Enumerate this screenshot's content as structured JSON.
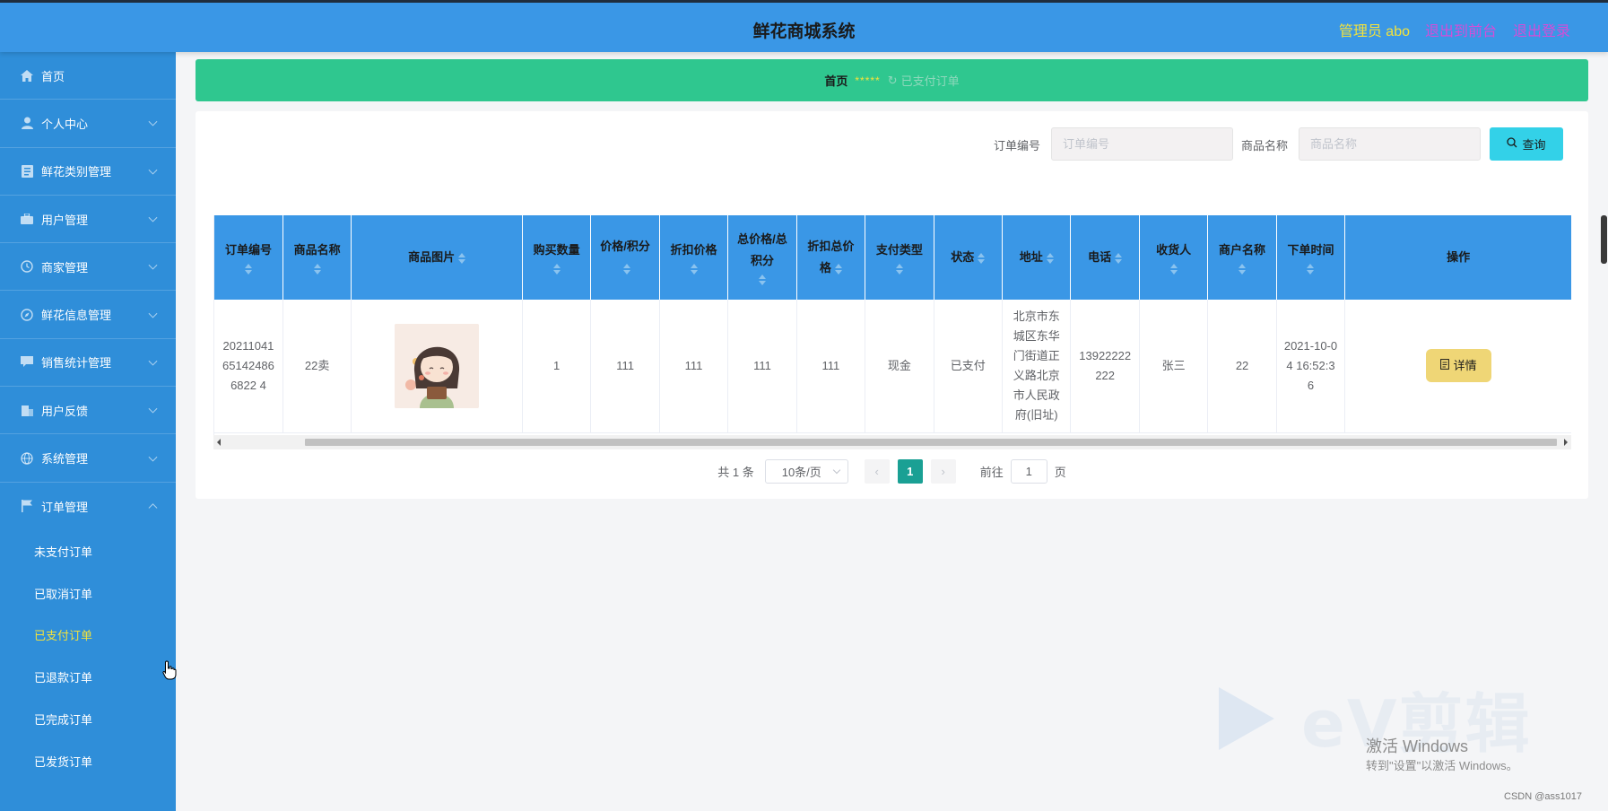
{
  "header": {
    "title": "鲜花商城系统",
    "user_label": "管理员 abo",
    "front_link": "退出到前台",
    "logout_link": "退出登录"
  },
  "sidebar": {
    "items": [
      {
        "label": "首页",
        "icon": "home-icon",
        "expandable": false
      },
      {
        "label": "个人中心",
        "icon": "user-icon",
        "expandable": true
      },
      {
        "label": "鲜花类别管理",
        "icon": "document-icon",
        "expandable": true
      },
      {
        "label": "用户管理",
        "icon": "briefcase-icon",
        "expandable": true
      },
      {
        "label": "商家管理",
        "icon": "clock-icon",
        "expandable": true
      },
      {
        "label": "鲜花信息管理",
        "icon": "compass-icon",
        "expandable": true
      },
      {
        "label": "销售统计管理",
        "icon": "chat-icon",
        "expandable": true
      },
      {
        "label": "用户反馈",
        "icon": "building-icon",
        "expandable": true
      },
      {
        "label": "系统管理",
        "icon": "globe-icon",
        "expandable": true
      },
      {
        "label": "订单管理",
        "icon": "flag-icon",
        "expandable": true,
        "expanded": true
      }
    ],
    "sub_items": [
      {
        "label": "未支付订单",
        "active": false
      },
      {
        "label": "已取消订单",
        "active": false
      },
      {
        "label": "已支付订单",
        "active": true
      },
      {
        "label": "已退款订单",
        "active": false
      },
      {
        "label": "已完成订单",
        "active": false
      },
      {
        "label": "已发货订单",
        "active": false
      }
    ]
  },
  "breadcrumb": {
    "home": "首页",
    "separator": "*****",
    "current": "已支付订单"
  },
  "search": {
    "order_label": "订单编号",
    "order_placeholder": "订单编号",
    "product_label": "商品名称",
    "product_placeholder": "商品名称",
    "button_label": "查询"
  },
  "table": {
    "columns": [
      "订单编号",
      "商品名称",
      "商品图片",
      "购买数量",
      "价格/积分",
      "折扣价格",
      "总价格/总积分",
      "折扣总价格",
      "支付类型",
      "状态",
      "地址",
      "电话",
      "收货人",
      "商户名称",
      "下单时间",
      "操作"
    ],
    "rows": [
      {
        "order_no": "20211041651424866822 4",
        "product_name": "22卖",
        "image": "anime-girl-thumbnail",
        "quantity": "1",
        "price": "111",
        "discount_price": "111",
        "total": "111",
        "discount_total": "111",
        "pay_type": "现金",
        "status": "已支付",
        "address": "北京市东城区东华门街道正义路北京市人民政府(旧址)",
        "phone": "13922222222",
        "receiver": "张三",
        "merchant": "22",
        "order_time": "2021-10-04 16:52:36",
        "action": "详情"
      }
    ]
  },
  "pagination": {
    "total_text": "共 1 条",
    "page_size": "10条/页",
    "current_page": "1",
    "goto_label": "前往",
    "goto_value": "1",
    "page_suffix": "页"
  },
  "watermarks": {
    "ev_text": "eV剪辑",
    "activate_title": "激活 Windows",
    "activate_sub": "转到\"设置\"以激活 Windows。",
    "csdn": "CSDN @ass1017"
  },
  "colors": {
    "header_bg": "#3a97e6",
    "sidebar_bg": "#2f8ed9",
    "breadcrumb_bg": "#2fc78f",
    "accent_yellow": "#f3e23b",
    "link_magenta": "#d44dd8",
    "search_button": "#33d1e8",
    "detail_button": "#efd676",
    "page_active": "#1aa094"
  }
}
